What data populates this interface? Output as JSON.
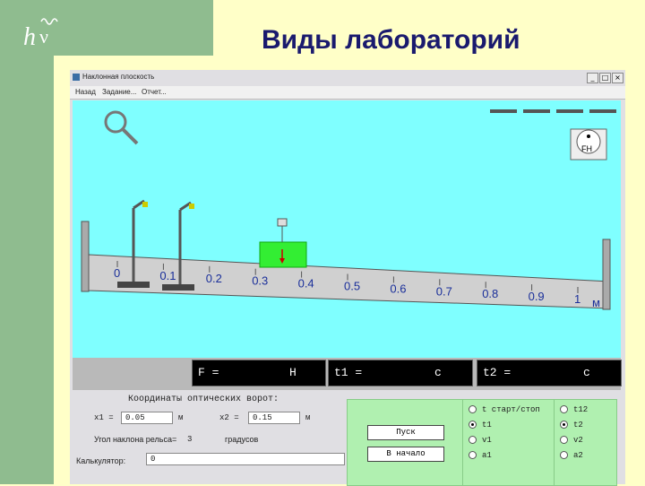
{
  "slide": {
    "title": "Виды лабораторий",
    "logo_text": "hν"
  },
  "window": {
    "title": "Наклонная плоскость",
    "menu": [
      "Назад",
      "Задание...",
      "Отчет..."
    ],
    "controls": [
      "_",
      "□",
      "×"
    ]
  },
  "scene": {
    "ruler_ticks": [
      "0",
      "0.1",
      "0.2",
      "0.3",
      "0.4",
      "0.5",
      "0.6",
      "0.7",
      "0.8",
      "0.9",
      "1"
    ],
    "ruler_unit": "м",
    "dynamometer_label": "FH",
    "cart_color": "#33ee33",
    "background_color": "#7fffff"
  },
  "readouts": {
    "force_label": "F =",
    "force_unit": "Н",
    "t1_label": "t1 =",
    "t1_unit": "с",
    "t2_label": "t2 =",
    "t2_unit": "с"
  },
  "controls": {
    "coords_title": "Координаты оптических ворот:",
    "x1_label": "x1 =",
    "x1_value": "0.05",
    "x1_unit": "м",
    "x2_label": "x2 =",
    "x2_value": "0.15",
    "x2_unit": "м",
    "angle_label": "Угол наклона рельса=",
    "angle_value": "3",
    "angle_unit": "градусов",
    "calc_label": "Калькулятор:",
    "calc_value": "0",
    "start_button": "Пуск",
    "reset_button": "В начало",
    "radios_left": [
      {
        "label": "t старт/стоп",
        "selected": false
      },
      {
        "label": "t1",
        "selected": true
      },
      {
        "label": "v1",
        "selected": false
      },
      {
        "label": "a1",
        "selected": false
      }
    ],
    "radios_right": [
      {
        "label": "t12",
        "selected": false
      },
      {
        "label": "t2",
        "selected": true
      },
      {
        "label": "v2",
        "selected": false
      },
      {
        "label": "a2",
        "selected": false
      }
    ]
  }
}
